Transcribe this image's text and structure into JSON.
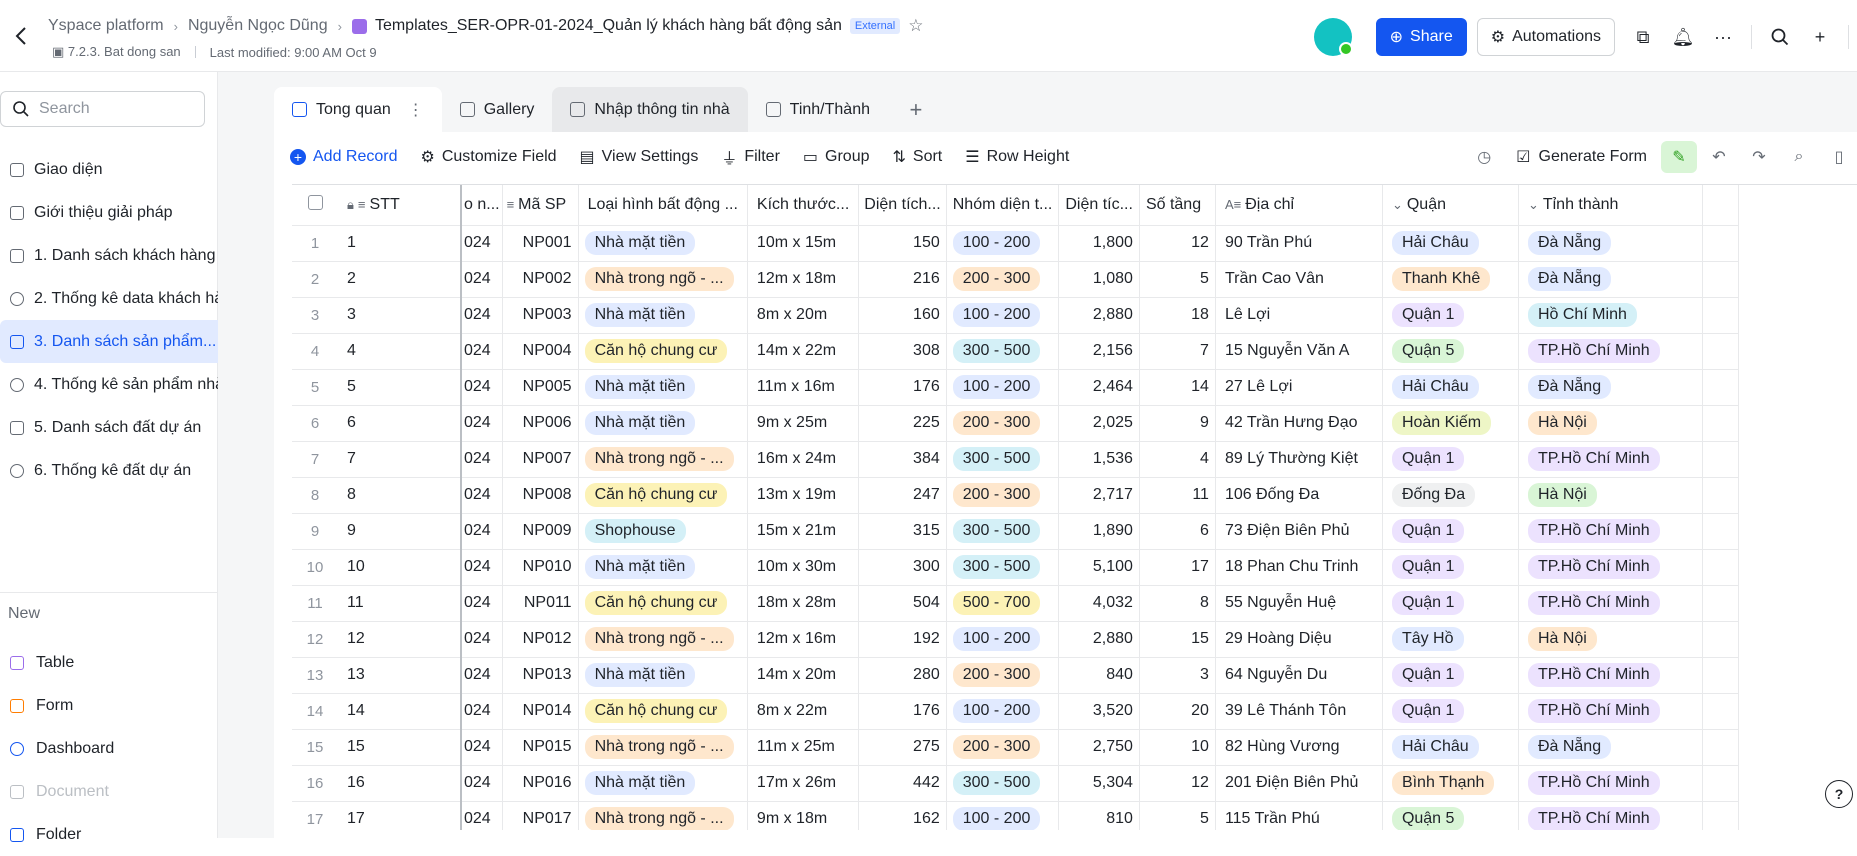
{
  "header": {
    "crumbs": [
      "Yspace platform",
      "Nguyễn Ngọc Dũng"
    ],
    "doc_title": "Templates_SER-OPR-01-2024_Quản lý khách hàng bất động sản",
    "badge": "External",
    "location": "7.2.3. Bat dong san",
    "last_modified": "Last modified: 9:00 AM Oct 9",
    "share_label": "Share",
    "automations_label": "Automations"
  },
  "sidebar": {
    "search_placeholder": "Search",
    "items": [
      {
        "label": "Giao diện",
        "icon": "doc-icon"
      },
      {
        "label": "Giới thiệu giải pháp",
        "icon": "doc-icon"
      },
      {
        "label": "1. Danh sách khách hàng",
        "icon": "table-icon"
      },
      {
        "label": "2. Thống kê data khách hà...",
        "icon": "dashboard-icon"
      },
      {
        "label": "3. Danh sách sản phẩm...",
        "icon": "table-icon"
      },
      {
        "label": "4. Thống kê sản phẩm nhà...",
        "icon": "dashboard-icon"
      },
      {
        "label": "5. Danh sách đất dự án",
        "icon": "table-icon"
      },
      {
        "label": "6. Thống kê đất dự án",
        "icon": "dashboard-icon"
      }
    ],
    "new_label": "New",
    "new_items": [
      {
        "label": "Table",
        "color": "#9b6dea"
      },
      {
        "label": "Form",
        "color": "#ff7d00"
      },
      {
        "label": "Dashboard",
        "color": "#1456f0"
      },
      {
        "label": "Document",
        "color": "#bbbfc4"
      },
      {
        "label": "Folder",
        "color": "#1456f0"
      }
    ]
  },
  "tabs": [
    {
      "label": "Tong quan"
    },
    {
      "label": "Gallery"
    },
    {
      "label": "Nhập thông tin nhà"
    },
    {
      "label": "Tinh/Thành"
    }
  ],
  "toolbar": {
    "add_record": "Add Record",
    "customize_field": "Customize Field",
    "view_settings": "View Settings",
    "filter": "Filter",
    "group": "Group",
    "sort": "Sort",
    "row_height": "Row Height",
    "generate_form": "Generate Form"
  },
  "table": {
    "headers": {
      "stt": "STT",
      "partial": "o n...",
      "ma_sp": "Mã SP",
      "loai_hinh": "Loại hình bất động ...",
      "kich_thuoc": "Kích thước...",
      "dien_tich": "Diện tích...",
      "nhom_dien_tich": "Nhóm diện t...",
      "dien_tich_2": "Diện tíc...",
      "so_tang": "Số tầng",
      "dia_chi": "Địa chỉ",
      "quan": "Quận",
      "tinh_thanh": "Tỉnh thành"
    },
    "rows": [
      {
        "n": "1",
        "stt": "1",
        "p": "024",
        "ma": "NP001",
        "loai": "Nhà mặt tiền",
        "loai_c": "blue",
        "kt": "10m x 15m",
        "dt": "150",
        "nhom": "100 - 200",
        "nhom_c": "blue",
        "dt2": "1,800",
        "tang": "12",
        "dc": "90 Trần Phú",
        "quan": "Hải Châu",
        "quan_c": "blue",
        "tinh": "Đà Nẵng",
        "tinh_c": "blue"
      },
      {
        "n": "2",
        "stt": "2",
        "p": "024",
        "ma": "NP002",
        "loai": "Nhà trong ngõ - ...",
        "loai_c": "orange",
        "kt": "12m x 18m",
        "dt": "216",
        "nhom": "200 - 300",
        "nhom_c": "orange",
        "dt2": "1,080",
        "tang": "5",
        "dc": "Trần Cao Vân",
        "quan": "Thanh Khê",
        "quan_c": "orange",
        "tinh": "Đà Nẵng",
        "tinh_c": "blue"
      },
      {
        "n": "3",
        "stt": "3",
        "p": "024",
        "ma": "NP003",
        "loai": "Nhà mặt tiền",
        "loai_c": "blue",
        "kt": "8m x 20m",
        "dt": "160",
        "nhom": "100 - 200",
        "nhom_c": "blue",
        "dt2": "2,880",
        "tang": "18",
        "dc": "Lê Lợi",
        "quan": "Quận 1",
        "quan_c": "purple",
        "tinh": "Hồ Chí Minh",
        "tinh_c": "cyan"
      },
      {
        "n": "4",
        "stt": "4",
        "p": "024",
        "ma": "NP004",
        "loai": "Căn hộ chung cư",
        "loai_c": "yellow",
        "kt": "14m x 22m",
        "dt": "308",
        "nhom": "300 - 500",
        "nhom_c": "cyan",
        "dt2": "2,156",
        "tang": "7",
        "dc": "15 Nguyễn Văn A",
        "quan": "Quận 5",
        "quan_c": "green",
        "tinh": "TP.Hồ Chí Minh",
        "tinh_c": "purple"
      },
      {
        "n": "5",
        "stt": "5",
        "p": "024",
        "ma": "NP005",
        "loai": "Nhà mặt tiền",
        "loai_c": "blue",
        "kt": "11m x 16m",
        "dt": "176",
        "nhom": "100 - 200",
        "nhom_c": "blue",
        "dt2": "2,464",
        "tang": "14",
        "dc": "27 Lê Lợi",
        "quan": "Hải Châu",
        "quan_c": "blue",
        "tinh": "Đà Nẵng",
        "tinh_c": "blue"
      },
      {
        "n": "6",
        "stt": "6",
        "p": "024",
        "ma": "NP006",
        "loai": "Nhà mặt tiền",
        "loai_c": "blue",
        "kt": "9m x 25m",
        "dt": "225",
        "nhom": "200 - 300",
        "nhom_c": "orange",
        "dt2": "2,025",
        "tang": "9",
        "dc": "42 Trần Hưng Đạo",
        "quan": "Hoàn Kiếm",
        "quan_c": "lime",
        "tinh": "Hà Nội",
        "tinh_c": "orange"
      },
      {
        "n": "7",
        "stt": "7",
        "p": "024",
        "ma": "NP007",
        "loai": "Nhà trong ngõ - ...",
        "loai_c": "orange",
        "kt": "16m x 24m",
        "dt": "384",
        "nhom": "300 - 500",
        "nhom_c": "cyan",
        "dt2": "1,536",
        "tang": "4",
        "dc": "89 Lý Thường Kiệt",
        "quan": "Quận 1",
        "quan_c": "purple",
        "tinh": "TP.Hồ Chí Minh",
        "tinh_c": "purple"
      },
      {
        "n": "8",
        "stt": "8",
        "p": "024",
        "ma": "NP008",
        "loai": "Căn hộ chung cư",
        "loai_c": "yellow",
        "kt": "13m x 19m",
        "dt": "247",
        "nhom": "200 - 300",
        "nhom_c": "orange",
        "dt2": "2,717",
        "tang": "11",
        "dc": "106 Đống Đa",
        "quan": "Đống Đa",
        "quan_c": "gray",
        "tinh": "Hà Nội",
        "tinh_c": "green"
      },
      {
        "n": "9",
        "stt": "9",
        "p": "024",
        "ma": "NP009",
        "loai": "Shophouse",
        "loai_c": "cyan",
        "kt": "15m x 21m",
        "dt": "315",
        "nhom": "300 - 500",
        "nhom_c": "cyan",
        "dt2": "1,890",
        "tang": "6",
        "dc": "73 Điện Biên Phủ",
        "quan": "Quận 1",
        "quan_c": "purple",
        "tinh": "TP.Hồ Chí Minh",
        "tinh_c": "purple"
      },
      {
        "n": "10",
        "stt": "10",
        "p": "024",
        "ma": "NP010",
        "loai": "Nhà mặt tiền",
        "loai_c": "blue",
        "kt": "10m x 30m",
        "dt": "300",
        "nhom": "300 - 500",
        "nhom_c": "cyan",
        "dt2": "5,100",
        "tang": "17",
        "dc": "18 Phan Chu Trinh",
        "quan": "Quận 1",
        "quan_c": "purple",
        "tinh": "TP.Hồ Chí Minh",
        "tinh_c": "purple"
      },
      {
        "n": "11",
        "stt": "11",
        "p": "024",
        "ma": "NP011",
        "loai": "Căn hộ chung cư",
        "loai_c": "yellow",
        "kt": "18m x 28m",
        "dt": "504",
        "nhom": "500 - 700",
        "nhom_c": "yellow",
        "dt2": "4,032",
        "tang": "8",
        "dc": "55 Nguyễn Huệ",
        "quan": "Quận 1",
        "quan_c": "purple",
        "tinh": "TP.Hồ Chí Minh",
        "tinh_c": "purple"
      },
      {
        "n": "12",
        "stt": "12",
        "p": "024",
        "ma": "NP012",
        "loai": "Nhà trong ngõ - ...",
        "loai_c": "orange",
        "kt": "12m x 16m",
        "dt": "192",
        "nhom": "100 - 200",
        "nhom_c": "blue",
        "dt2": "2,880",
        "tang": "15",
        "dc": "29 Hoàng Diệu",
        "quan": "Tây Hồ",
        "quan_c": "blue",
        "tinh": "Hà Nội",
        "tinh_c": "orange"
      },
      {
        "n": "13",
        "stt": "13",
        "p": "024",
        "ma": "NP013",
        "loai": "Nhà mặt tiền",
        "loai_c": "blue",
        "kt": "14m x 20m",
        "dt": "280",
        "nhom": "200 - 300",
        "nhom_c": "orange",
        "dt2": "840",
        "tang": "3",
        "dc": "64 Nguyễn Du",
        "quan": "Quận 1",
        "quan_c": "purple",
        "tinh": "TP.Hồ Chí Minh",
        "tinh_c": "purple"
      },
      {
        "n": "14",
        "stt": "14",
        "p": "024",
        "ma": "NP014",
        "loai": "Căn hộ chung cư",
        "loai_c": "yellow",
        "kt": "8m x 22m",
        "dt": "176",
        "nhom": "100 - 200",
        "nhom_c": "blue",
        "dt2": "3,520",
        "tang": "20",
        "dc": "39 Lê Thánh Tôn",
        "quan": "Quận 1",
        "quan_c": "purple",
        "tinh": "TP.Hồ Chí Minh",
        "tinh_c": "purple"
      },
      {
        "n": "15",
        "stt": "15",
        "p": "024",
        "ma": "NP015",
        "loai": "Nhà trong ngõ - ...",
        "loai_c": "orange",
        "kt": "11m x 25m",
        "dt": "275",
        "nhom": "200 - 300",
        "nhom_c": "orange",
        "dt2": "2,750",
        "tang": "10",
        "dc": "82 Hùng Vương",
        "quan": "Hải Châu",
        "quan_c": "blue",
        "tinh": "Đà Nẵng",
        "tinh_c": "blue"
      },
      {
        "n": "16",
        "stt": "16",
        "p": "024",
        "ma": "NP016",
        "loai": "Nhà mặt tiền",
        "loai_c": "blue",
        "kt": "17m x 26m",
        "dt": "442",
        "nhom": "300 - 500",
        "nhom_c": "cyan",
        "dt2": "5,304",
        "tang": "12",
        "dc": "201 Điện Biên Phủ",
        "quan": "Bình Thạnh",
        "quan_c": "orange",
        "tinh": "TP.Hồ Chí Minh",
        "tinh_c": "purple"
      },
      {
        "n": "17",
        "stt": "17",
        "p": "024",
        "ma": "NP017",
        "loai": "Nhà trong ngõ - ...",
        "loai_c": "orange",
        "kt": "9m x 18m",
        "dt": "162",
        "nhom": "100 - 200",
        "nhom_c": "blue",
        "dt2": "810",
        "tang": "5",
        "dc": "115 Trần Phú",
        "quan": "Quận 5",
        "quan_c": "green",
        "tinh": "TP.Hồ Chí Minh",
        "tinh_c": "purple"
      }
    ]
  },
  "help_label": "?"
}
